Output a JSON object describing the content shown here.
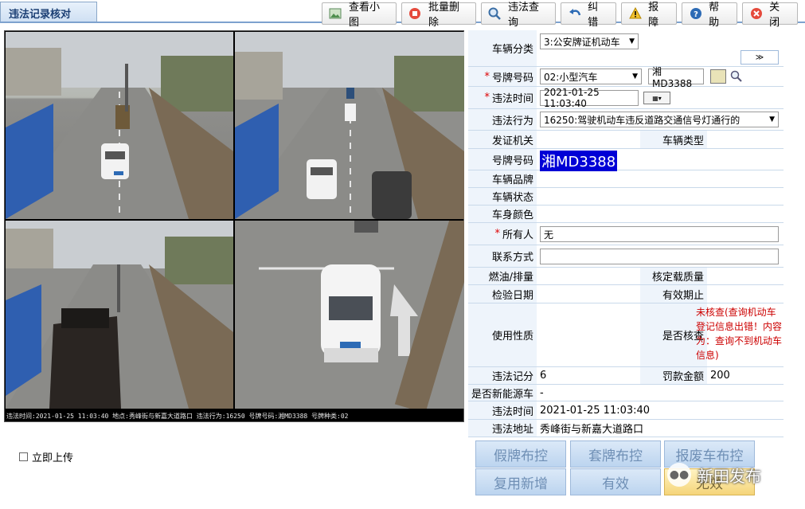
{
  "window": {
    "tab_title": "违法记录核对"
  },
  "toolbar": {
    "thumbnails": "查看小图",
    "batch_delete": "批量删除",
    "violation_query": "违法查询",
    "correction": "纠错",
    "report": "报障",
    "help": "帮助",
    "close": "关闭"
  },
  "camera": {
    "info_bar": "违法时间:2021-01-25 11:03:40 地点:秀峰街与新嘉大道路口 违法行为:16250 号牌号码:湘MD3388 号牌种类:02",
    "frame_stamp": "2021-01-25 11:03:40 秀峰街与新嘉大道路口"
  },
  "form": {
    "vehicle_category": {
      "label": "车辆分类",
      "value": "3:公安牌证机动车"
    },
    "plate_number": {
      "label": "号牌号码",
      "type": "02:小型汽车",
      "value": "湘MD3388"
    },
    "violation_time": {
      "label": "违法时间",
      "value": "2021-01-25 11:03:40"
    },
    "violation_act": {
      "label": "违法行为",
      "value": "16250:驾驶机动车违反道路交通信号灯通行的"
    },
    "issuing_authority": {
      "label": "发证机关",
      "value": ""
    },
    "vehicle_type": {
      "label": "车辆类型",
      "value": ""
    },
    "plate_display": {
      "label": "号牌号码",
      "value": "湘MD3388"
    },
    "brand": {
      "label": "车辆品牌",
      "value": ""
    },
    "status": {
      "label": "车辆状态",
      "value": ""
    },
    "color": {
      "label": "车身颜色",
      "value": ""
    },
    "owner": {
      "label": "所有人",
      "value": "无"
    },
    "contact": {
      "label": "联系方式",
      "value": ""
    },
    "fuel": {
      "label": "燃油/排量",
      "value": ""
    },
    "rated_load": {
      "label": "核定载质量",
      "value": ""
    },
    "inspection_date": {
      "label": "检验日期",
      "value": ""
    },
    "valid_until": {
      "label": "有效期止",
      "value": ""
    },
    "usage": {
      "label": "使用性质",
      "value": ""
    },
    "verified": {
      "label": "是否核查",
      "value": "未核查(查询机动车登记信息出错！内容为：查询不到机动车信息)"
    },
    "points": {
      "label": "违法记分",
      "value": "6"
    },
    "fine": {
      "label": "罚款金额",
      "value": "200"
    },
    "new_energy": {
      "label": "是否新能源车",
      "value": "-"
    },
    "violation_time2": {
      "label": "违法时间",
      "value": "2021-01-25 11:03:40"
    },
    "address": {
      "label": "违法地址",
      "value": "秀峰街与新嘉大道路口"
    }
  },
  "actions": {
    "fake_plate": "假牌布控",
    "cloned_plate": "套牌布控",
    "scrapped": "报废车布控",
    "reuse": "复用新增",
    "valid": "有效",
    "invalid": "无效"
  },
  "upload_now": "立即上传",
  "watermark": "新田发布",
  "colors": {
    "accent": "#1b3f74",
    "required": "#dd0000",
    "warning_text": "#cc0000"
  }
}
